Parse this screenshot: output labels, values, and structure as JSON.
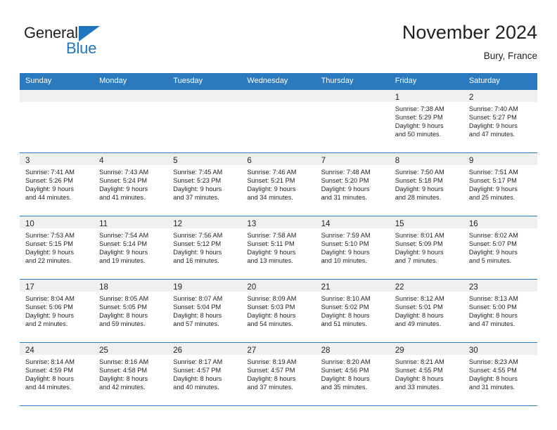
{
  "brand": {
    "name_part1": "General",
    "name_part2": "Blue",
    "accent_color": "#1f76bc"
  },
  "header": {
    "month_title": "November 2024",
    "location": "Bury, France"
  },
  "calendar": {
    "header_bg": "#2b7ac0",
    "daynum_bg": "#f0f0f0",
    "weekday_headers": [
      "Sunday",
      "Monday",
      "Tuesday",
      "Wednesday",
      "Thursday",
      "Friday",
      "Saturday"
    ],
    "weeks": [
      [
        {
          "day": "",
          "sunrise": "",
          "sunset": "",
          "daylight_line1": "",
          "daylight_line2": ""
        },
        {
          "day": "",
          "sunrise": "",
          "sunset": "",
          "daylight_line1": "",
          "daylight_line2": ""
        },
        {
          "day": "",
          "sunrise": "",
          "sunset": "",
          "daylight_line1": "",
          "daylight_line2": ""
        },
        {
          "day": "",
          "sunrise": "",
          "sunset": "",
          "daylight_line1": "",
          "daylight_line2": ""
        },
        {
          "day": "",
          "sunrise": "",
          "sunset": "",
          "daylight_line1": "",
          "daylight_line2": ""
        },
        {
          "day": "1",
          "sunrise": "Sunrise: 7:38 AM",
          "sunset": "Sunset: 5:29 PM",
          "daylight_line1": "Daylight: 9 hours",
          "daylight_line2": "and 50 minutes."
        },
        {
          "day": "2",
          "sunrise": "Sunrise: 7:40 AM",
          "sunset": "Sunset: 5:27 PM",
          "daylight_line1": "Daylight: 9 hours",
          "daylight_line2": "and 47 minutes."
        }
      ],
      [
        {
          "day": "3",
          "sunrise": "Sunrise: 7:41 AM",
          "sunset": "Sunset: 5:26 PM",
          "daylight_line1": "Daylight: 9 hours",
          "daylight_line2": "and 44 minutes."
        },
        {
          "day": "4",
          "sunrise": "Sunrise: 7:43 AM",
          "sunset": "Sunset: 5:24 PM",
          "daylight_line1": "Daylight: 9 hours",
          "daylight_line2": "and 41 minutes."
        },
        {
          "day": "5",
          "sunrise": "Sunrise: 7:45 AM",
          "sunset": "Sunset: 5:23 PM",
          "daylight_line1": "Daylight: 9 hours",
          "daylight_line2": "and 37 minutes."
        },
        {
          "day": "6",
          "sunrise": "Sunrise: 7:46 AM",
          "sunset": "Sunset: 5:21 PM",
          "daylight_line1": "Daylight: 9 hours",
          "daylight_line2": "and 34 minutes."
        },
        {
          "day": "7",
          "sunrise": "Sunrise: 7:48 AM",
          "sunset": "Sunset: 5:20 PM",
          "daylight_line1": "Daylight: 9 hours",
          "daylight_line2": "and 31 minutes."
        },
        {
          "day": "8",
          "sunrise": "Sunrise: 7:50 AM",
          "sunset": "Sunset: 5:18 PM",
          "daylight_line1": "Daylight: 9 hours",
          "daylight_line2": "and 28 minutes."
        },
        {
          "day": "9",
          "sunrise": "Sunrise: 7:51 AM",
          "sunset": "Sunset: 5:17 PM",
          "daylight_line1": "Daylight: 9 hours",
          "daylight_line2": "and 25 minutes."
        }
      ],
      [
        {
          "day": "10",
          "sunrise": "Sunrise: 7:53 AM",
          "sunset": "Sunset: 5:15 PM",
          "daylight_line1": "Daylight: 9 hours",
          "daylight_line2": "and 22 minutes."
        },
        {
          "day": "11",
          "sunrise": "Sunrise: 7:54 AM",
          "sunset": "Sunset: 5:14 PM",
          "daylight_line1": "Daylight: 9 hours",
          "daylight_line2": "and 19 minutes."
        },
        {
          "day": "12",
          "sunrise": "Sunrise: 7:56 AM",
          "sunset": "Sunset: 5:12 PM",
          "daylight_line1": "Daylight: 9 hours",
          "daylight_line2": "and 16 minutes."
        },
        {
          "day": "13",
          "sunrise": "Sunrise: 7:58 AM",
          "sunset": "Sunset: 5:11 PM",
          "daylight_line1": "Daylight: 9 hours",
          "daylight_line2": "and 13 minutes."
        },
        {
          "day": "14",
          "sunrise": "Sunrise: 7:59 AM",
          "sunset": "Sunset: 5:10 PM",
          "daylight_line1": "Daylight: 9 hours",
          "daylight_line2": "and 10 minutes."
        },
        {
          "day": "15",
          "sunrise": "Sunrise: 8:01 AM",
          "sunset": "Sunset: 5:09 PM",
          "daylight_line1": "Daylight: 9 hours",
          "daylight_line2": "and 7 minutes."
        },
        {
          "day": "16",
          "sunrise": "Sunrise: 8:02 AM",
          "sunset": "Sunset: 5:07 PM",
          "daylight_line1": "Daylight: 9 hours",
          "daylight_line2": "and 5 minutes."
        }
      ],
      [
        {
          "day": "17",
          "sunrise": "Sunrise: 8:04 AM",
          "sunset": "Sunset: 5:06 PM",
          "daylight_line1": "Daylight: 9 hours",
          "daylight_line2": "and 2 minutes."
        },
        {
          "day": "18",
          "sunrise": "Sunrise: 8:05 AM",
          "sunset": "Sunset: 5:05 PM",
          "daylight_line1": "Daylight: 8 hours",
          "daylight_line2": "and 59 minutes."
        },
        {
          "day": "19",
          "sunrise": "Sunrise: 8:07 AM",
          "sunset": "Sunset: 5:04 PM",
          "daylight_line1": "Daylight: 8 hours",
          "daylight_line2": "and 57 minutes."
        },
        {
          "day": "20",
          "sunrise": "Sunrise: 8:09 AM",
          "sunset": "Sunset: 5:03 PM",
          "daylight_line1": "Daylight: 8 hours",
          "daylight_line2": "and 54 minutes."
        },
        {
          "day": "21",
          "sunrise": "Sunrise: 8:10 AM",
          "sunset": "Sunset: 5:02 PM",
          "daylight_line1": "Daylight: 8 hours",
          "daylight_line2": "and 51 minutes."
        },
        {
          "day": "22",
          "sunrise": "Sunrise: 8:12 AM",
          "sunset": "Sunset: 5:01 PM",
          "daylight_line1": "Daylight: 8 hours",
          "daylight_line2": "and 49 minutes."
        },
        {
          "day": "23",
          "sunrise": "Sunrise: 8:13 AM",
          "sunset": "Sunset: 5:00 PM",
          "daylight_line1": "Daylight: 8 hours",
          "daylight_line2": "and 47 minutes."
        }
      ],
      [
        {
          "day": "24",
          "sunrise": "Sunrise: 8:14 AM",
          "sunset": "Sunset: 4:59 PM",
          "daylight_line1": "Daylight: 8 hours",
          "daylight_line2": "and 44 minutes."
        },
        {
          "day": "25",
          "sunrise": "Sunrise: 8:16 AM",
          "sunset": "Sunset: 4:58 PM",
          "daylight_line1": "Daylight: 8 hours",
          "daylight_line2": "and 42 minutes."
        },
        {
          "day": "26",
          "sunrise": "Sunrise: 8:17 AM",
          "sunset": "Sunset: 4:57 PM",
          "daylight_line1": "Daylight: 8 hours",
          "daylight_line2": "and 40 minutes."
        },
        {
          "day": "27",
          "sunrise": "Sunrise: 8:19 AM",
          "sunset": "Sunset: 4:57 PM",
          "daylight_line1": "Daylight: 8 hours",
          "daylight_line2": "and 37 minutes."
        },
        {
          "day": "28",
          "sunrise": "Sunrise: 8:20 AM",
          "sunset": "Sunset: 4:56 PM",
          "daylight_line1": "Daylight: 8 hours",
          "daylight_line2": "and 35 minutes."
        },
        {
          "day": "29",
          "sunrise": "Sunrise: 8:21 AM",
          "sunset": "Sunset: 4:55 PM",
          "daylight_line1": "Daylight: 8 hours",
          "daylight_line2": "and 33 minutes."
        },
        {
          "day": "30",
          "sunrise": "Sunrise: 8:23 AM",
          "sunset": "Sunset: 4:55 PM",
          "daylight_line1": "Daylight: 8 hours",
          "daylight_line2": "and 31 minutes."
        }
      ]
    ]
  }
}
